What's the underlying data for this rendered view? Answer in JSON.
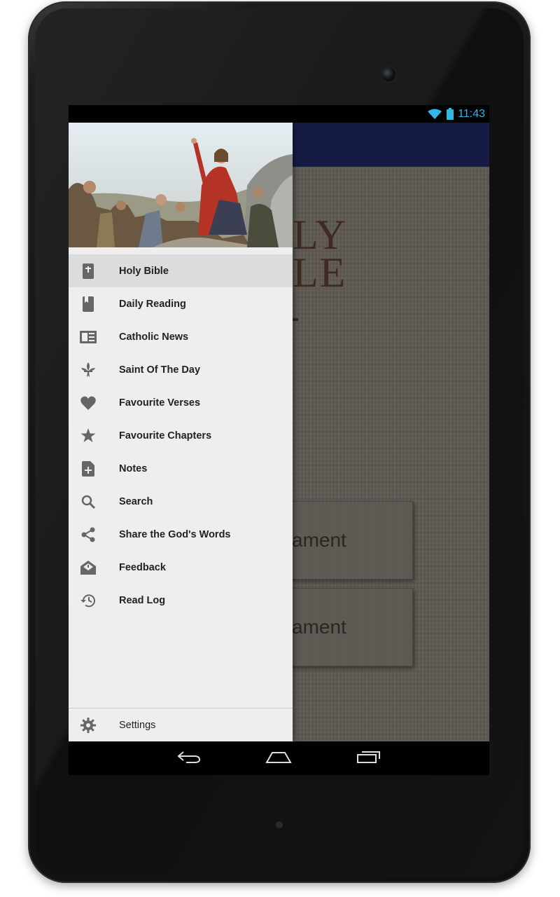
{
  "status_bar": {
    "time": "11:43",
    "icons": [
      "wifi-icon",
      "battery-icon"
    ],
    "accent_color": "#33b5e5"
  },
  "app_bar": {
    "color": "#161b45"
  },
  "background_content": {
    "title_line1": "LY",
    "title_line2": "LE",
    "button1_label": "ament",
    "button2_label": "ament"
  },
  "drawer": {
    "header_image": "sermon-on-the-mount-painting",
    "items": [
      {
        "label": "Holy Bible",
        "icon": "bible-icon",
        "active": true
      },
      {
        "label": "Daily Reading",
        "icon": "book-icon"
      },
      {
        "label": "Catholic News",
        "icon": "newspaper-icon"
      },
      {
        "label": "Saint Of The Day",
        "icon": "fleur-de-lis-icon"
      },
      {
        "label": "Favourite Verses",
        "icon": "heart-icon"
      },
      {
        "label": "Favourite Chapters",
        "icon": "star-icon"
      },
      {
        "label": "Notes",
        "icon": "note-add-icon"
      },
      {
        "label": "Search",
        "icon": "search-icon"
      },
      {
        "label": "Share the God's Words",
        "icon": "share-icon"
      },
      {
        "label": "Feedback",
        "icon": "feedback-mail-icon"
      },
      {
        "label": "Read Log",
        "icon": "history-icon"
      }
    ],
    "footer": {
      "label": "Settings",
      "icon": "gear-icon"
    }
  },
  "nav_bar": {
    "buttons": [
      "back-icon",
      "home-icon",
      "recents-icon"
    ]
  }
}
